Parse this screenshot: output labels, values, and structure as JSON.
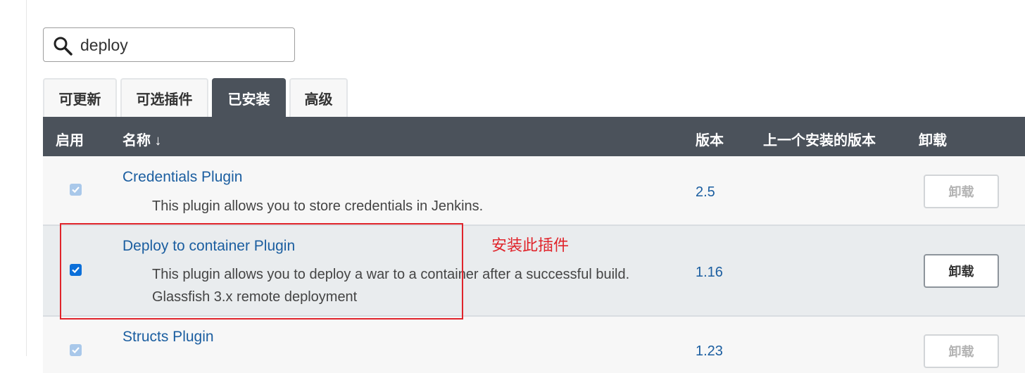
{
  "search": {
    "value": "deploy",
    "icon": "search-icon"
  },
  "tabs": [
    {
      "label": "可更新"
    },
    {
      "label": "可选插件"
    },
    {
      "label": "已安装",
      "active": true
    },
    {
      "label": "高级"
    }
  ],
  "table": {
    "headers": {
      "enabled": "启用",
      "name": "名称 ↓",
      "version": "版本",
      "previous_version": "上一个安装的版本",
      "uninstall": "卸载"
    },
    "rows": [
      {
        "name": "Credentials Plugin",
        "description": "This plugin allows you to store credentials in Jenkins.",
        "version": "2.5",
        "checked": true,
        "checkbox_enabled": false,
        "uninstall_label": "卸载",
        "uninstall_enabled": false
      },
      {
        "name": "Deploy to container Plugin",
        "description": "This plugin allows you to deploy a war to a container after a successful build.",
        "description_line2": "Glassfish 3.x remote deployment",
        "version": "1.16",
        "checked": true,
        "checkbox_enabled": true,
        "uninstall_label": "卸载",
        "uninstall_enabled": true
      },
      {
        "name": "Structs Plugin",
        "version": "1.23",
        "checked": true,
        "checkbox_enabled": false,
        "uninstall_label": "卸载",
        "uninstall_enabled": false
      }
    ]
  },
  "annotation": {
    "text": "安装此插件",
    "color": "#e0242b"
  },
  "colors": {
    "header_bg": "#4b525b",
    "link": "#1b5ea0",
    "checkbox_active": "#0b6fd9"
  }
}
